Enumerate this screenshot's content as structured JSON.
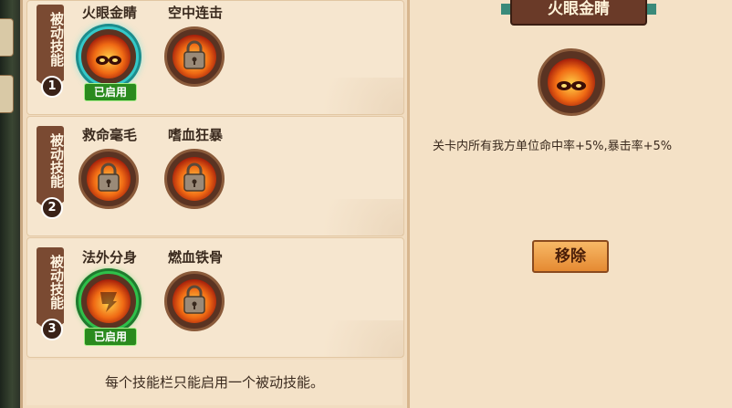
{
  "slots": [
    {
      "ribbon_label": "被动技能",
      "number": "1",
      "skills": [
        {
          "name": "火眼金睛",
          "state": "selected",
          "badge": "已启用"
        },
        {
          "name": "空中连击",
          "state": "locked",
          "badge": null
        }
      ]
    },
    {
      "ribbon_label": "被动技能",
      "number": "2",
      "skills": [
        {
          "name": "救命毫毛",
          "state": "locked",
          "badge": null
        },
        {
          "name": "嗜血狂暴",
          "state": "locked",
          "badge": null
        }
      ]
    },
    {
      "ribbon_label": "被动技能",
      "number": "3",
      "skills": [
        {
          "name": "法外分身",
          "state": "active",
          "badge": "已启用"
        },
        {
          "name": "燃血铁骨",
          "state": "locked",
          "badge": null
        }
      ]
    }
  ],
  "footer_note": "每个技能栏只能启用一个被动技能。",
  "detail": {
    "title": "火眼金睛",
    "description": "关卡内所有我方单位命中率+5%,暴击率+5%",
    "remove_button": "移除"
  },
  "colors": {
    "panel_bg": "#f1dcc0",
    "active_ring": "#2fc04a",
    "selected_ring": "#34c8c8",
    "button": "#e58a32",
    "ribbon": "#7a4a32"
  },
  "icons": {
    "lock": "lock-icon",
    "fire_eyes": "fire-eyes-icon",
    "flame_scroll": "flame-scroll-icon"
  }
}
